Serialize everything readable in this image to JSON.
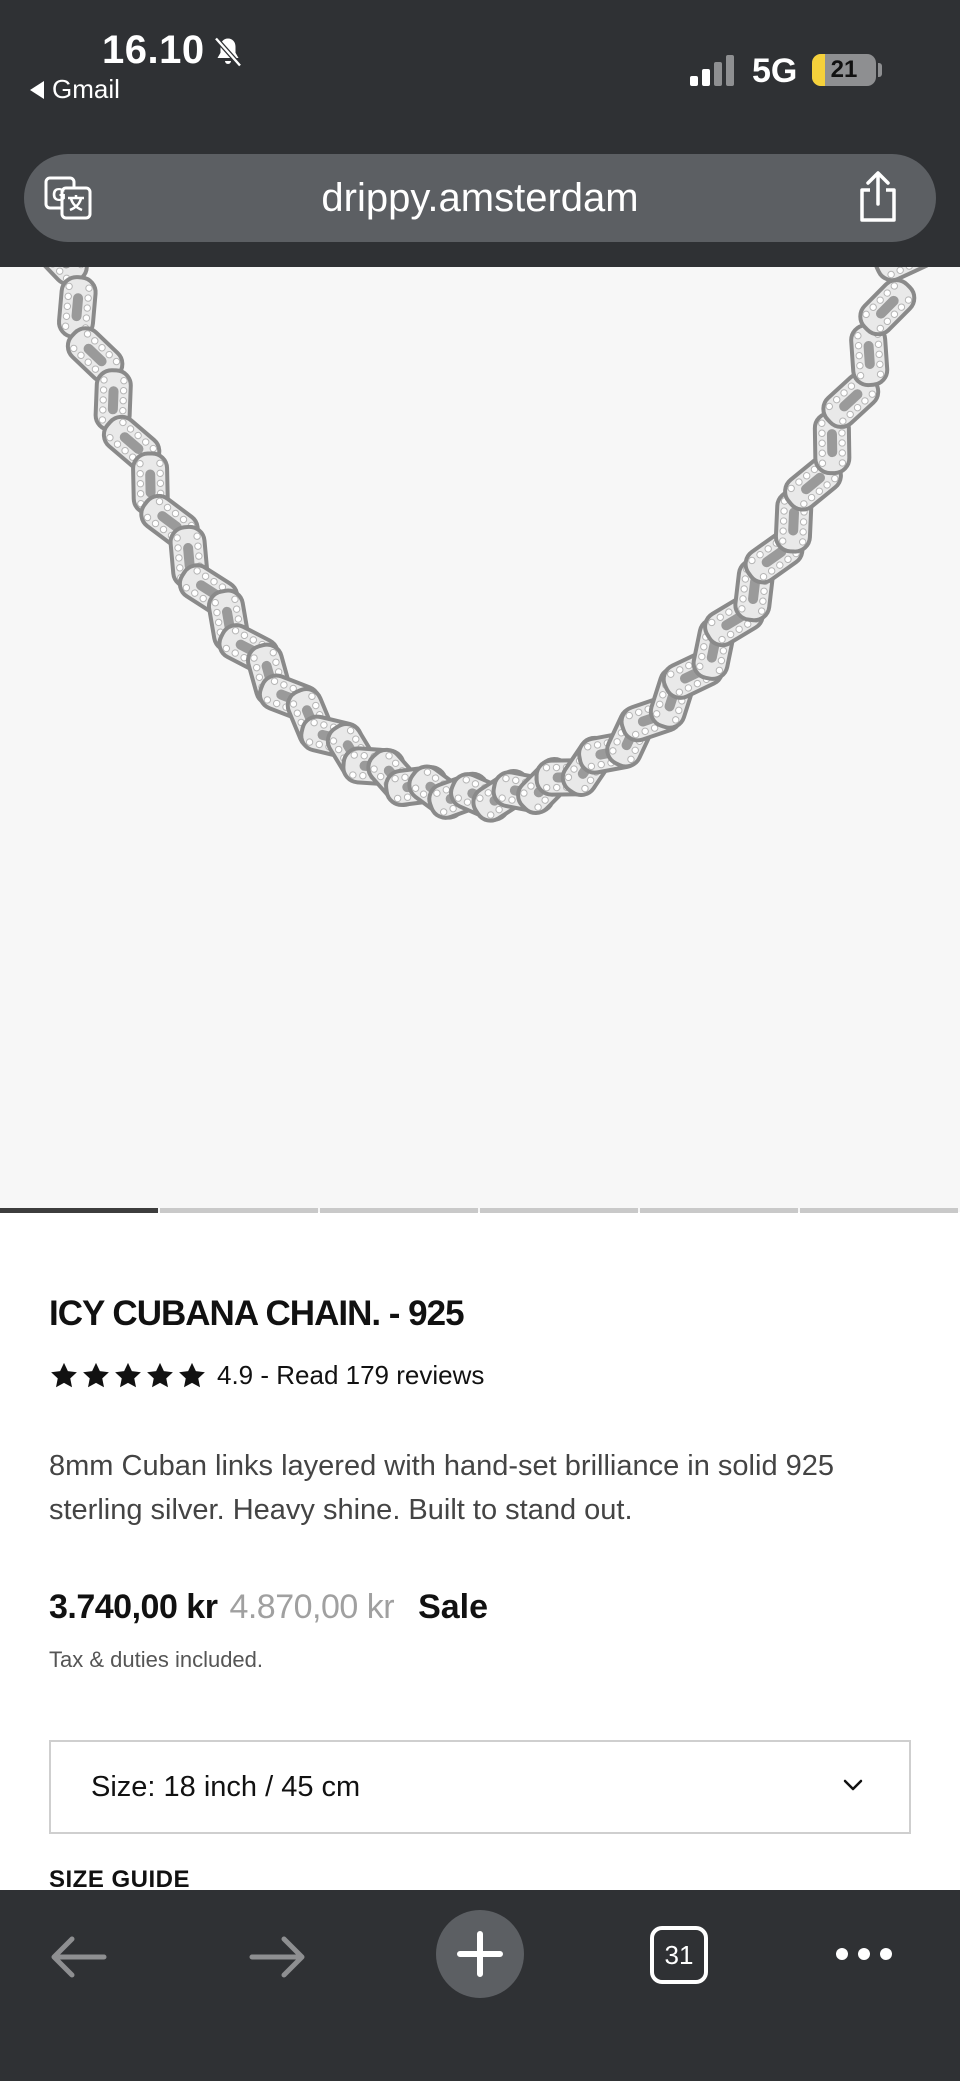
{
  "status_bar": {
    "time": "16.10",
    "back_app": "Gmail",
    "network": "5G",
    "battery": "21",
    "battery_level": 0.21
  },
  "browser": {
    "url": "drippy.amsterdam",
    "tab_count": "31"
  },
  "gallery": {
    "total_images": 6,
    "active_index": 0
  },
  "product": {
    "title": "ICY CUBANA CHAIN. - 925",
    "rating_stars": 5,
    "rating_text": "4.9 - Read 179 reviews",
    "description": "8mm Cuban links layered with hand-set brilliance in solid 925 sterling silver. Heavy shine. Built to stand out.",
    "price_current": "3.740,00 kr",
    "price_old": "4.870,00 kr",
    "sale_label": "Sale",
    "tax_note": "Tax & duties included.",
    "size_select": "Size: 18 inch / 45 cm",
    "size_guide": "SIZE GUIDE"
  },
  "colors": {
    "chrome": "#2f3134",
    "url_bar": "#5c5f63",
    "battery_accent": "#f5d13b",
    "old_price": "#a0a0a0"
  },
  "icons": [
    "bell-muted-icon",
    "signal-icon",
    "translate-icon",
    "share-icon",
    "star-icon",
    "chevron-down-icon",
    "back-arrow-icon",
    "forward-arrow-icon",
    "plus-icon",
    "more-icon"
  ]
}
